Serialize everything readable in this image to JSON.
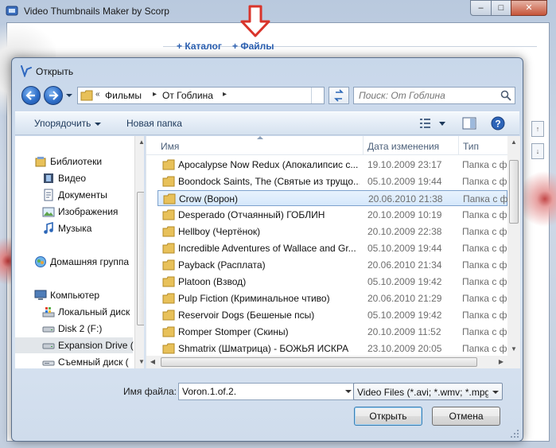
{
  "app": {
    "title": "Video Thumbnails Maker by Scorp",
    "links": {
      "catalog": "+ Каталог",
      "files": "+ Файлы"
    },
    "win_min": "‒",
    "win_max": "□",
    "win_close": "✕"
  },
  "dialog": {
    "title": "Открыть",
    "address": {
      "chevron": "«",
      "crumbs": [
        "Фильмы",
        "От Гоблина"
      ],
      "sep": "▸"
    },
    "search_placeholder": "Поиск: От Гоблина",
    "toolbar": {
      "organize": "Упорядочить",
      "new_folder": "Новая папка"
    },
    "nav": {
      "items": [
        {
          "label": "Библиотеки",
          "icon": "libraries-icon",
          "level": 0
        },
        {
          "label": "Видео",
          "icon": "video-library-icon",
          "level": 1
        },
        {
          "label": "Документы",
          "icon": "documents-library-icon",
          "level": 1
        },
        {
          "label": "Изображения",
          "icon": "pictures-library-icon",
          "level": 1
        },
        {
          "label": "Музыка",
          "icon": "music-library-icon",
          "level": 1
        },
        {
          "label": "Домашняя группа",
          "icon": "homegroup-icon",
          "level": 0
        },
        {
          "label": "Компьютер",
          "icon": "computer-icon",
          "level": 0
        },
        {
          "label": "Локальный диск",
          "icon": "windows-drive-icon",
          "level": 1
        },
        {
          "label": "Disk 2 (F:)",
          "icon": "hard-drive-icon",
          "level": 1
        },
        {
          "label": "Expansion Drive (",
          "icon": "hard-drive-icon",
          "level": 1,
          "selected": true
        },
        {
          "label": "Съемный диск (",
          "icon": "removable-drive-icon",
          "level": 1
        }
      ]
    },
    "columns": {
      "name": "Имя",
      "date": "Дата изменения",
      "type": "Тип"
    },
    "files": [
      {
        "name": "Apocalypse Now Redux (Апокалипсис с...",
        "date": "19.10.2009 23:17",
        "type": "Папка с ф"
      },
      {
        "name": "Boondock Saints, The (Святые из трущо...",
        "date": "05.10.2009 19:44",
        "type": "Папка с ф"
      },
      {
        "name": "Crow (Ворон)",
        "date": "20.06.2010 21:38",
        "type": "Папка с ф",
        "selected": true
      },
      {
        "name": "Desperado (Отчаянный) ГОБЛИН",
        "date": "20.10.2009 10:19",
        "type": "Папка с ф"
      },
      {
        "name": "Hellboy (Чертёнок)",
        "date": "20.10.2009 22:38",
        "type": "Папка с ф"
      },
      {
        "name": "Incredible Adventures of Wallace and Gr...",
        "date": "05.10.2009 19:44",
        "type": "Папка с ф"
      },
      {
        "name": "Payback (Расплата)",
        "date": "20.06.2010 21:34",
        "type": "Папка с ф"
      },
      {
        "name": "Platoon (Взвод)",
        "date": "05.10.2009 19:42",
        "type": "Папка с ф"
      },
      {
        "name": "Pulp Fiction (Криминальное чтиво)",
        "date": "20.06.2010 21:29",
        "type": "Папка с ф"
      },
      {
        "name": "Reservoir Dogs (Бешеные псы)",
        "date": "05.10.2009 19:42",
        "type": "Папка с ф"
      },
      {
        "name": "Romper Stomper (Скины)",
        "date": "20.10.2009 11:52",
        "type": "Папка с ф"
      },
      {
        "name": "Shmatrix (Шматрица) - БОЖЬЯ ИСКРА",
        "date": "23.10.2009 20:05",
        "type": "Папка с ф"
      }
    ],
    "filename_label": "Имя файла:",
    "filename_value": "Voron.1.of.2.",
    "filter_value": "Video Files (*.avi; *.wmv; *.mpg",
    "open_button": "Открыть",
    "cancel_button": "Отмена",
    "scroll": {
      "up": "▲",
      "down": "▼",
      "left": "◀",
      "right": "▶"
    }
  },
  "colors": {
    "accent": "#2b5fb0",
    "selection": "#d6e8fb",
    "arrow_red": "#d9342b"
  }
}
